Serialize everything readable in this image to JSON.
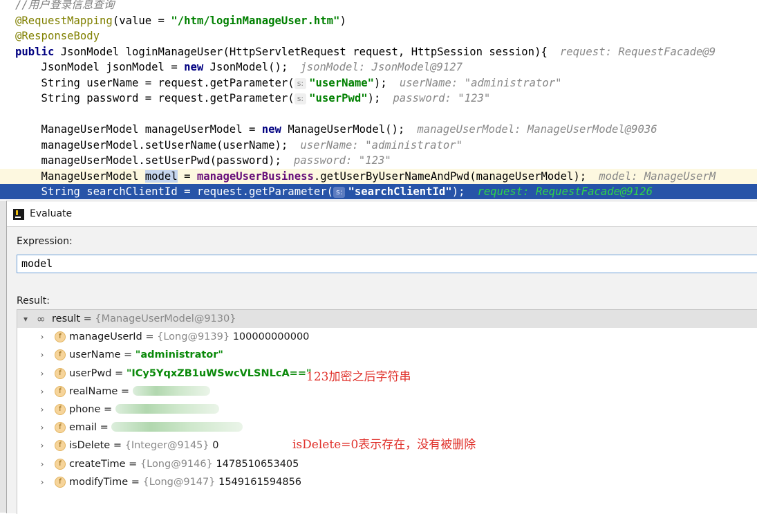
{
  "editor": {
    "line1_comment": "//用户登录信息查询",
    "line2_annotation": "@RequestMapping",
    "line2_args_pre": "(value = ",
    "line2_str": "\"/htm/loginManageUser.htm\"",
    "line2_args_post": ")",
    "line3_annotation": "@ResponseBody",
    "line4_kw": "public",
    "line4_code": " JsonModel loginManageUser(HttpServletRequest request, HttpSession session){",
    "line4_hint": "request: RequestFacade@9",
    "line5_pre": "    JsonModel jsonModel = ",
    "line5_kw": "new",
    "line5_post": " JsonModel();",
    "line5_hint": "jsonModel: JsonModel@9127",
    "line6_pre": "    String userName = request.getParameter(",
    "param_badge": "s:",
    "line6_str": "\"userName\"",
    "line6_post": ");",
    "line6_hint": "userName: \"administrator\"",
    "line7_pre": "    String password = request.getParameter(",
    "line7_str": "\"userPwd\"",
    "line7_post": ");",
    "line7_hint": "password: \"123\"",
    "line9_pre": "    ManageUserModel manageUserModel = ",
    "line9_kw": "new",
    "line9_post": " ManageUserModel();",
    "line9_hint": "manageUserModel: ManageUserModel@9036",
    "line10_code": "    manageUserModel.setUserName(userName);",
    "line10_hint": "userName: \"administrator\"",
    "line11_code": "    manageUserModel.setUserPwd(password);",
    "line11_hint": "password: \"123\"",
    "line12_pre": "    ManageUserModel ",
    "line12_sel": "model",
    "line12_mid": " = ",
    "line12_field": "manageUserBusiness",
    "line12_post": ".getUserByUserNameAndPwd(manageUserModel);",
    "line12_hint": "model: ManageUserM",
    "line13_pre": "    String searchClientId = request.getParameter(",
    "line13_str": "\"searchClientId\"",
    "line13_post": ");",
    "line13_hint": "request: RequestFacade@9126"
  },
  "dialog": {
    "title": "Evaluate",
    "expression_label": "Expression:",
    "expression_value": "model",
    "result_label": "Result:"
  },
  "result": {
    "root_name": "result",
    "root_eq": " = ",
    "root_ref": "{ManageUserModel@9130}",
    "field_icon": "f",
    "fields": [
      {
        "name": "manageUserId",
        "ref": "{Long@9139}",
        "value": "100000000000"
      },
      {
        "name": "userName",
        "value_str": "\"administrator\""
      },
      {
        "name": "userPwd",
        "value_str": "\"ICy5YqxZB1uWSwcVLSNLcA==\""
      },
      {
        "name": "realName",
        "eq": " = "
      },
      {
        "name": "phone",
        "eq": " = "
      },
      {
        "name": "email",
        "eq": " = "
      },
      {
        "name": "isDelete",
        "ref": "{Integer@9145}",
        "value": "0"
      },
      {
        "name": "createTime",
        "ref": "{Long@9146}",
        "value": "1478510653405"
      },
      {
        "name": "modifyTime",
        "ref": "{Long@9147}",
        "value": "1549161594856"
      }
    ]
  },
  "notes": {
    "pwd_note": "123加密之后字符串",
    "delete_note": "isDelete=0表示存在，没有被删除"
  },
  "colors": {
    "selection_line": "#2754a8",
    "current_line": "#fdf8e0",
    "annotation_red": "#e0312b"
  }
}
